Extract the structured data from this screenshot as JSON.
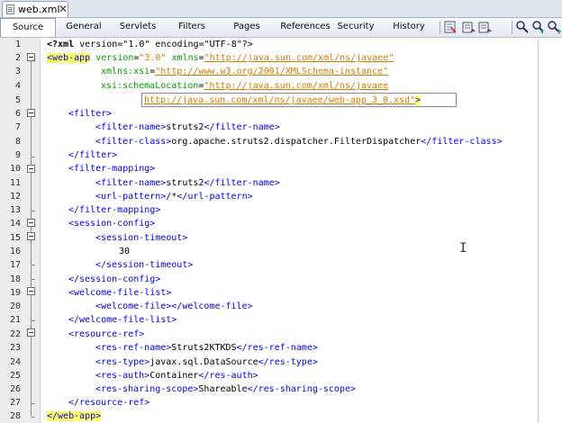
{
  "file_tab": {
    "name": "web.xml",
    "close": "✕",
    "icon": "xml-file-icon"
  },
  "view_tabs": [
    "Source",
    "General",
    "Servlets",
    "Filters",
    "Pages",
    "References",
    "Security",
    "History"
  ],
  "active_view": "Source",
  "toolbar_icons": [
    "last-edit-icon",
    "back-icon",
    "forward-icon",
    "find-icon",
    "find-previous-icon",
    "find-next-icon",
    "toggle-highlight-icon"
  ],
  "code": {
    "line_numbers": [
      "1",
      "2",
      "3",
      "4",
      "5",
      "6",
      "7",
      "8",
      "9",
      "10",
      "11",
      "12",
      "13",
      "14",
      "15",
      "16",
      "17",
      "18",
      "19",
      "20",
      "21",
      "22",
      "23",
      "24",
      "25",
      "26",
      "27",
      "28"
    ],
    "l1": {
      "pi_open": "<?xml",
      "text": " version=\"1.0\" encoding=\"UTF-8\"?>"
    },
    "l2": {
      "tag": "<web-app",
      "attr1": " version",
      "eq1": "=",
      "val1": "\"3.0\"",
      "attr2": " xmlns",
      "eq2": "=",
      "url2": "\"http://java.sun.com/xml/ns/javaee\""
    },
    "l3": {
      "attr": "xmlns:xsi",
      "eq": "=",
      "url": "\"http://www.w3.org/2001/XMLSchema-instance\""
    },
    "l4": {
      "attr": "xsi:schemaLocation",
      "eq": "=",
      "url": "\"http://java.sun.com/xml/ns/javaee"
    },
    "l5": {
      "url": "http://java.sun.com/xml/ns/javaee/web-app_3_0.xsd\"",
      "close": ">"
    },
    "l6": {
      "tag": "<filter>"
    },
    "l7": {
      "open": "<filter-name>",
      "text": "struts2",
      "close": "</filter-name>"
    },
    "l8": {
      "open": "<filter-class>",
      "text": "org.apache.struts2.dispatcher.FilterDispatcher",
      "close": "</filter-class>"
    },
    "l9": {
      "tag": "</filter>"
    },
    "l10": {
      "tag": "<filter-mapping>"
    },
    "l11": {
      "open": "<filter-name>",
      "text": "struts2",
      "close": "</filter-name>"
    },
    "l12": {
      "open": "<url-pattern>",
      "text": "/*",
      "close": "</url-pattern>"
    },
    "l13": {
      "tag": "</filter-mapping>"
    },
    "l14": {
      "tag": "<session-config>"
    },
    "l15": {
      "tag": "<session-timeout>"
    },
    "l16": {
      "text": "30"
    },
    "l17": {
      "tag": "</session-timeout>"
    },
    "l18": {
      "tag": "</session-config>"
    },
    "l19": {
      "tag": "<welcome-file-list>"
    },
    "l20": {
      "tag": "<welcome-file></welcome-file>"
    },
    "l21": {
      "tag": "</welcome-file-list>"
    },
    "l22": {
      "tag": "<resource-ref>"
    },
    "l23": {
      "open": "<res-ref-name>",
      "text": "Struts2KTKDS",
      "close": "</res-ref-name>"
    },
    "l24": {
      "open": "<res-type>",
      "text": "javax.sql.DataSource",
      "close": "</res-type>"
    },
    "l25": {
      "open": "<res-auth>",
      "text": "Container",
      "close": "</res-auth>"
    },
    "l26": {
      "open": "<res-sharing-scope>",
      "text": "Shareable",
      "close": "</res-sharing-scope>"
    },
    "l27": {
      "tag": "</resource-ref>"
    },
    "l28": {
      "tag": "</web-app>"
    }
  }
}
